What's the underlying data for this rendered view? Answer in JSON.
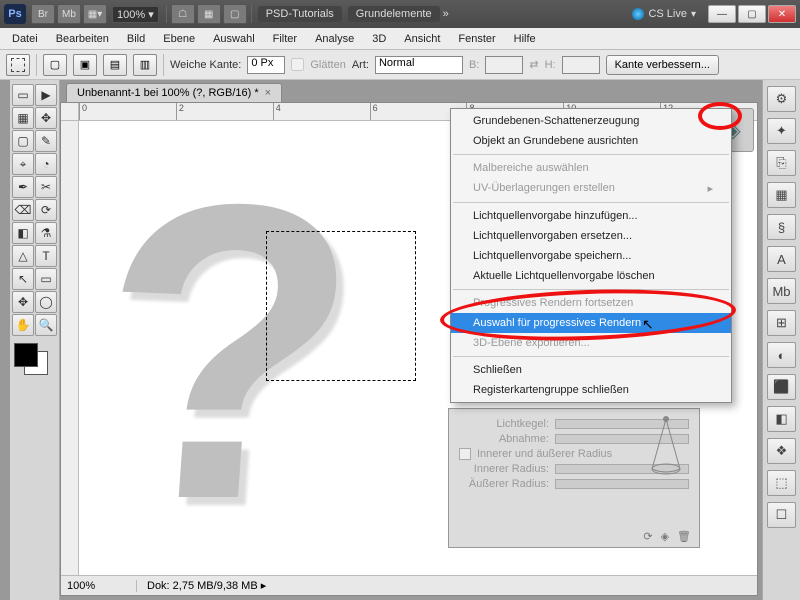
{
  "titlebar": {
    "app_abbrev": "Ps",
    "btn_br": "Br",
    "btn_mb": "Mb",
    "zoom_value": "100%",
    "doc1": "PSD-Tutorials",
    "doc2": "Grundelemente",
    "chevrons": "»",
    "cslive": "CS Live"
  },
  "menu": {
    "items": [
      "Datei",
      "Bearbeiten",
      "Bild",
      "Ebene",
      "Auswahl",
      "Filter",
      "Analyse",
      "3D",
      "Ansicht",
      "Fenster",
      "Hilfe"
    ]
  },
  "optbar": {
    "weiche_kante_label": "Weiche Kante:",
    "weiche_kante_value": "0 Px",
    "glaetten_label": "Glätten",
    "art_label": "Art:",
    "art_value": "Normal",
    "b_label": "B:",
    "h_label": "H:",
    "kante_btn": "Kante verbessern..."
  },
  "tab": {
    "title": "Unbenannt-1 bei 100% (?, RGB/16) *"
  },
  "ruler": {
    "ticks": [
      "0",
      "2",
      "4",
      "6",
      "8",
      "10",
      "12"
    ]
  },
  "status": {
    "zoom": "100%",
    "dok": "Dok: 2,75 MB/9,38 MB"
  },
  "ctx": {
    "items": [
      {
        "label": "Grundebenen-Schattenerzeugung",
        "disabled": false
      },
      {
        "label": "Objekt an Grundebene ausrichten",
        "disabled": false
      },
      {
        "sep": true
      },
      {
        "label": "Malbereiche auswählen",
        "disabled": true
      },
      {
        "label": "UV-Überlagerungen erstellen",
        "disabled": true,
        "sub": true
      },
      {
        "sep": true
      },
      {
        "label": "Lichtquellenvorgabe hinzufügen...",
        "disabled": false
      },
      {
        "label": "Lichtquellenvorgaben ersetzen...",
        "disabled": false
      },
      {
        "label": "Lichtquellenvorgabe speichern...",
        "disabled": false
      },
      {
        "label": "Aktuelle Lichtquellenvorgabe löschen",
        "disabled": false
      },
      {
        "sep": true
      },
      {
        "label": "Progressives Rendern fortsetzen",
        "disabled": true
      },
      {
        "label": "Auswahl für progressives Rendern",
        "selected": true
      },
      {
        "label": "3D-Ebene exportieren...",
        "disabled": true
      },
      {
        "sep": true
      },
      {
        "label": "Schließen",
        "disabled": false
      },
      {
        "label": "Registerkartengruppe schließen",
        "disabled": false
      }
    ]
  },
  "panel": {
    "lichtkegel": "Lichtkegel:",
    "abnahme": "Abnahme:",
    "inner_outer": "Innerer und äußerer Radius",
    "inner": "Innerer Radius:",
    "outer": "Äußerer Radius:"
  },
  "tools": {
    "glyphs": [
      "▭",
      "▶",
      "▦",
      "✥",
      "▢",
      "✎",
      "⌖",
      "◔",
      "✒",
      "✂",
      "⌫",
      "⟳",
      "◧",
      "⚗",
      "△",
      "✎",
      "⊘",
      "◌",
      "✒",
      "T",
      "↖",
      "▭",
      "✥",
      "◯",
      "✋",
      "🔍"
    ]
  },
  "right_icons": [
    "⚙",
    "✦",
    "⎘",
    "▦",
    "§",
    "A",
    "Mb",
    "⊞",
    "◐",
    "⬛",
    "◧",
    "❖",
    "⬚",
    "☐"
  ]
}
